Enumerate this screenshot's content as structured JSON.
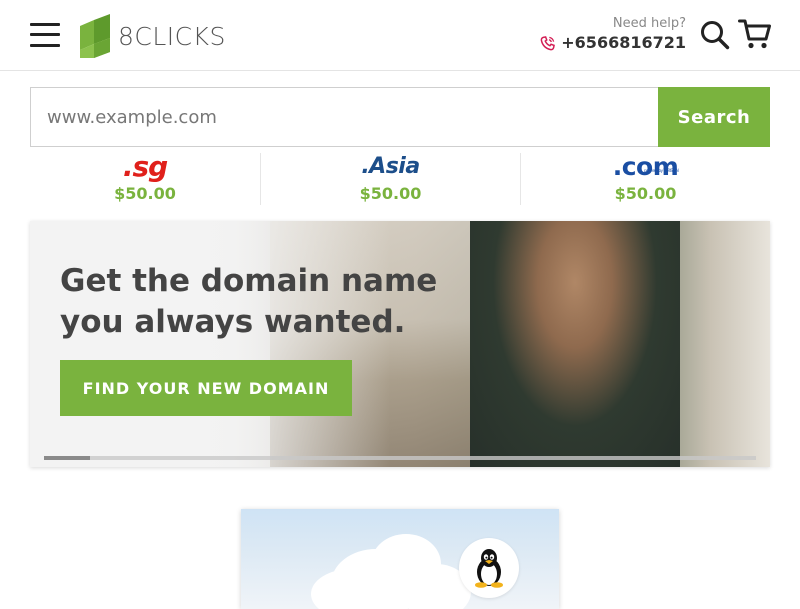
{
  "header": {
    "logo_text": "8CLICKS",
    "help_label": "Need help?",
    "phone": "+6566816721",
    "icons": [
      "menu-icon",
      "search-icon",
      "cart-icon",
      "phone-icon"
    ]
  },
  "search": {
    "placeholder": "www.example.com",
    "button_label": "Search"
  },
  "tlds": [
    {
      "name": ".sg",
      "price": "$50.00"
    },
    {
      "name": ".Asia",
      "price": "$50.00"
    },
    {
      "name": ".com",
      "sub": "powered by VERISIGN",
      "price": "$50.00"
    }
  ],
  "hero": {
    "title": "Get the domain name you always wanted.",
    "cta_label": "FIND YOUR NEW DOMAIN",
    "progress": 0.065
  },
  "os_card": {
    "icon": "linux-tux-icon"
  },
  "colors": {
    "brand_green": "#7ab33e",
    "sg_red": "#e0201b",
    "asia_blue": "#1c4e8a",
    "com_blue": "#1a4ea3"
  }
}
